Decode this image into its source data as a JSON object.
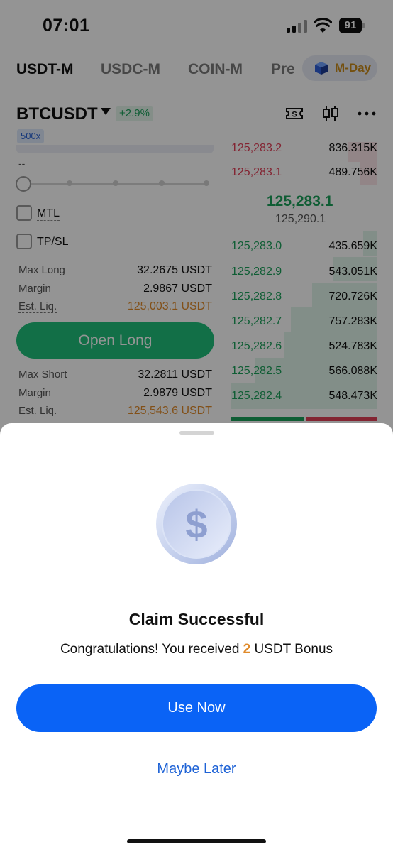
{
  "status_bar": {
    "time": "07:01",
    "battery": "91"
  },
  "tabs": [
    {
      "label": "USDT-M",
      "active": true
    },
    {
      "label": "USDC-M",
      "active": false
    },
    {
      "label": "COIN-M",
      "active": false
    },
    {
      "label": "Pre",
      "active": false
    }
  ],
  "promo": {
    "label": "M-Day"
  },
  "pair": {
    "name": "BTCUSDT",
    "change": "+2.9%",
    "leverage": "500x"
  },
  "header_icons": [
    "ticket-icon",
    "candlestick-icon",
    "more-icon"
  ],
  "order_form": {
    "dash": "--",
    "checkboxes": [
      {
        "label": "MTL"
      },
      {
        "label": "TP/SL"
      }
    ],
    "long_info": [
      {
        "label": "Max Long",
        "value": "32.2675 USDT"
      },
      {
        "label": "Margin",
        "value": "2.9867 USDT"
      },
      {
        "label": "Est. Liq.",
        "value": "125,003.1 USDT"
      }
    ],
    "open_long_label": "Open Long",
    "short_info": [
      {
        "label": "Max Short",
        "value": "32.2811 USDT"
      },
      {
        "label": "Margin",
        "value": "2.9879 USDT"
      },
      {
        "label": "Est. Liq.",
        "value": "125,543.6 USDT"
      }
    ]
  },
  "order_book": {
    "asks": [
      {
        "price": "125,283.2",
        "qty": "836.315K"
      },
      {
        "price": "125,283.1",
        "qty": "489.756K"
      }
    ],
    "last_price": "125,283.1",
    "mark_price": "125,290.1",
    "bids": [
      {
        "price": "125,283.0",
        "qty": "435.659K"
      },
      {
        "price": "125,282.9",
        "qty": "543.051K"
      },
      {
        "price": "125,282.8",
        "qty": "720.726K"
      },
      {
        "price": "125,282.7",
        "qty": "757.283K"
      },
      {
        "price": "125,282.6",
        "qty": "524.783K"
      },
      {
        "price": "125,282.5",
        "qty": "566.088K"
      },
      {
        "price": "125,282.4",
        "qty": "548.473K"
      }
    ]
  },
  "modal": {
    "title": "Claim Successful",
    "message_prefix": "Congratulations! You received ",
    "amount": "2",
    "message_suffix": " USDT Bonus",
    "primary_label": "Use Now",
    "secondary_label": "Maybe Later"
  },
  "colors": {
    "buy_green": "#1aa15a",
    "sell_red": "#e23e57",
    "primary_blue": "#0a63f6",
    "bonus_orange": "#e08a2a"
  }
}
